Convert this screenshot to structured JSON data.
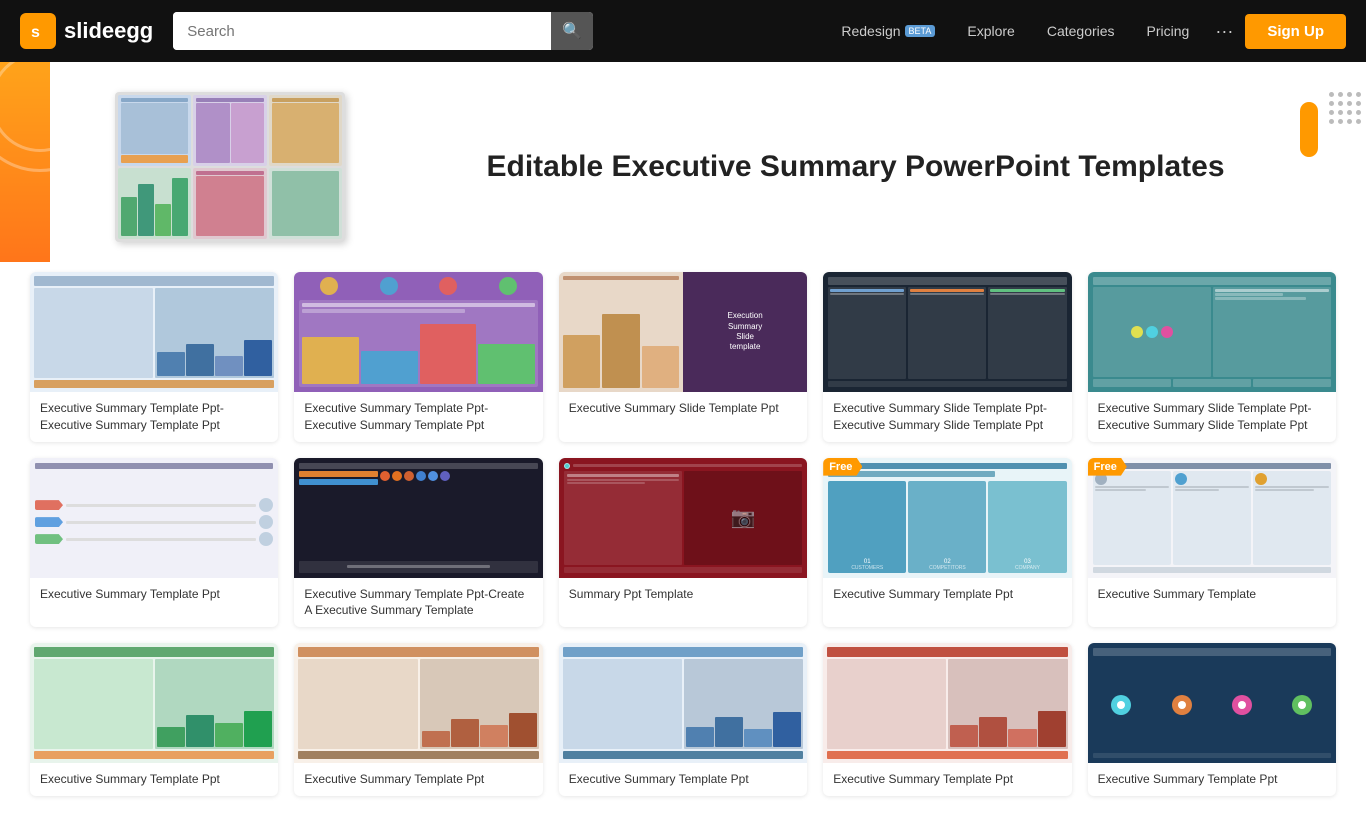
{
  "header": {
    "logo_text": "slideegg",
    "logo_initial": "s",
    "search_placeholder": "Search",
    "nav_redesign": "Redesign",
    "nav_beta": "BETA",
    "nav_explore": "Explore",
    "nav_categories": "Categories",
    "nav_pricing": "Pricing",
    "nav_more": "···",
    "signup_label": "Sign Up"
  },
  "hero": {
    "title": "Editable Executive Summary PowerPoint Templates"
  },
  "grid": {
    "cards": [
      {
        "id": 1,
        "label": "Executive Summary Template Ppt-Executive Summary Template Ppt",
        "thumb_style": "light-blue",
        "free": false
      },
      {
        "id": 2,
        "label": "Executive Summary Template Ppt-Executive Summary Template Ppt",
        "thumb_style": "purple",
        "free": false
      },
      {
        "id": 3,
        "label": "Executive Summary Slide Template Ppt",
        "thumb_style": "dark-split",
        "free": false
      },
      {
        "id": 4,
        "label": "Executive Summary Slide Template Ppt-Executive Summary Slide Template Ppt",
        "thumb_style": "dark",
        "free": false
      },
      {
        "id": 5,
        "label": "Executive Summary Slide Template Ppt-Executive Summary Slide Template Ppt",
        "thumb_style": "teal",
        "free": false
      },
      {
        "id": 6,
        "label": "Executive Summary Template Ppt",
        "thumb_style": "arrows",
        "free": false
      },
      {
        "id": 7,
        "label": "Executive Summary Template Ppt-Create A Executive Summary Template",
        "thumb_style": "dark-figures",
        "free": false
      },
      {
        "id": 8,
        "label": "Summary Ppt Template",
        "thumb_style": "red-circle",
        "free": false
      },
      {
        "id": 9,
        "label": "Executive Summary Template Ppt",
        "thumb_style": "free-blue",
        "free": true
      },
      {
        "id": 10,
        "label": "Executive Summary Template",
        "thumb_style": "free-white",
        "free": true
      },
      {
        "id": 11,
        "label": "Executive Summary Template Ppt",
        "thumb_style": "green",
        "free": false
      },
      {
        "id": 12,
        "label": "Executive Summary Template Ppt",
        "thumb_style": "light-orange",
        "free": false
      },
      {
        "id": 13,
        "label": "Executive Summary Template Ppt",
        "thumb_style": "light-blue2",
        "free": false
      },
      {
        "id": 14,
        "label": "Executive Summary Template Ppt",
        "thumb_style": "red-bar",
        "free": false
      },
      {
        "id": 15,
        "label": "Executive Summary Template Ppt",
        "thumb_style": "teal2",
        "free": false
      }
    ]
  }
}
